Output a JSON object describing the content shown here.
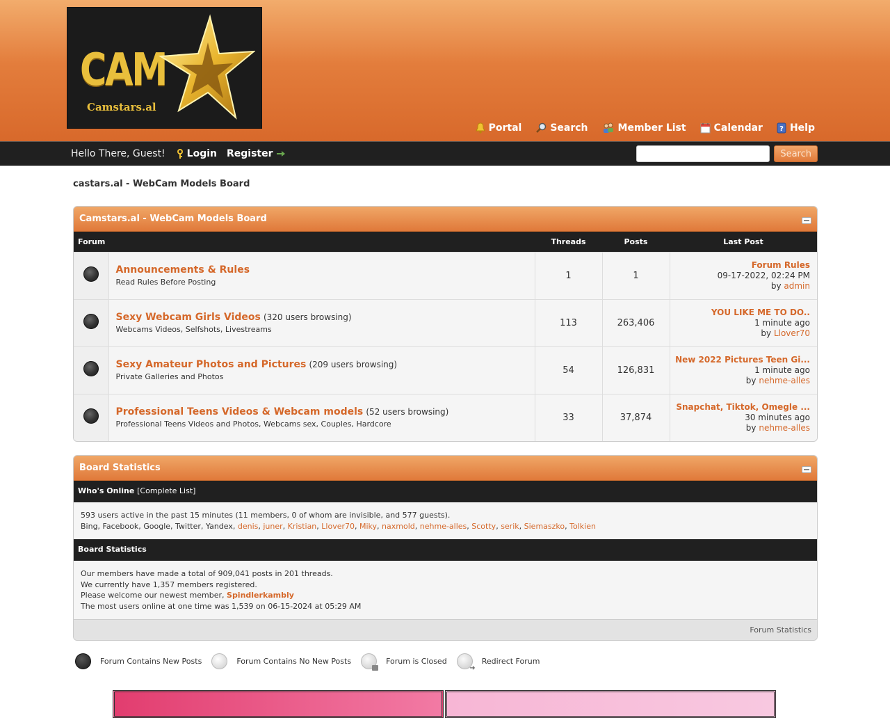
{
  "header": {
    "logo_text": "CAM",
    "logo_site": "Camstars.al",
    "links": [
      {
        "label": "Portal",
        "icon": "bell-icon"
      },
      {
        "label": "Search",
        "icon": "search-icon"
      },
      {
        "label": "Member List",
        "icon": "members-icon"
      },
      {
        "label": "Calendar",
        "icon": "calendar-icon"
      },
      {
        "label": "Help",
        "icon": "help-icon"
      }
    ]
  },
  "panel": {
    "greeting": "Hello There, Guest!",
    "login": "Login",
    "register": "Register",
    "search_button": "Search",
    "search_value": ""
  },
  "breadcrumb": "castars.al - WebCam Models Board",
  "forum_table": {
    "title": "Camstars.al - WebCam Models Board",
    "columns": [
      "Forum",
      "Threads",
      "Posts",
      "Last Post"
    ],
    "forums": [
      {
        "title": "Announcements & Rules",
        "browsing": "",
        "description": "Read Rules Before Posting",
        "threads": "1",
        "posts": "1",
        "last_title": "Forum Rules",
        "last_time": "09-17-2022, 02:24 PM",
        "last_by": "by",
        "last_user": "admin"
      },
      {
        "title": "Sexy Webcam Girls Videos",
        "browsing": "(320 users browsing)",
        "description": "Webcams Videos, Selfshots, Livestreams",
        "threads": "113",
        "posts": "263,406",
        "last_title": "YOU LIKE ME TO DO..",
        "last_time": "1 minute ago",
        "last_by": "by",
        "last_user": "Llover70"
      },
      {
        "title": "Sexy Amateur Photos and Pictures",
        "browsing": "(209 users browsing)",
        "description": "Private Galleries and Photos",
        "threads": "54",
        "posts": "126,831",
        "last_title": "New 2022 Pictures Teen Gi...",
        "last_time": "1 minute ago",
        "last_by": "by",
        "last_user": "nehme-alles"
      },
      {
        "title": "Professional Teens Videos & Webcam models",
        "browsing": "(52 users browsing)",
        "description": "Professional Teens Videos and Photos, Webcams sex, Couples, Hardcore",
        "threads": "33",
        "posts": "37,874",
        "last_title": "Snapchat, Tiktok, Omegle ...",
        "last_time": "30 minutes ago",
        "last_by": "by",
        "last_user": "nehme-alles"
      }
    ]
  },
  "stats": {
    "title": "Board Statistics",
    "online_header": "Who's Online",
    "complete_list": "[Complete List]",
    "online_line": "593 users active in the past 15 minutes (11 members, 0 of whom are invisible, and 577 guests).",
    "bots": "Bing, Facebook, Google, Twitter, Yandex,",
    "members": [
      "denis",
      "juner",
      "Kristian",
      "Llover70",
      "Miky",
      "naxmold",
      "nehme-alles",
      "Scotty",
      "serik",
      "Siemaszko",
      "Tolkien"
    ],
    "stats_header": "Board Statistics",
    "line1": "Our members have made a total of 909,041 posts in 201 threads.",
    "line2": "We currently have 1,357 members registered.",
    "line3_prefix": "Please welcome our newest member,",
    "newest_member": "Spindlerkambly",
    "line4": "The most users online at one time was 1,539 on 06-15-2024 at 05:29 AM",
    "footer_link": "Forum Statistics"
  },
  "legend": [
    {
      "label": "Forum Contains New Posts",
      "icon": "new-posts-icon"
    },
    {
      "label": "Forum Contains No New Posts",
      "icon": "no-new-posts-icon"
    },
    {
      "label": "Forum is Closed",
      "icon": "closed-icon"
    },
    {
      "label": "Redirect Forum",
      "icon": "redirect-icon"
    }
  ],
  "colors": {
    "accent": "#d5682a",
    "header_top": "#f2ac6c",
    "header_bottom": "#d8692b",
    "dark_bar": "#202020"
  }
}
